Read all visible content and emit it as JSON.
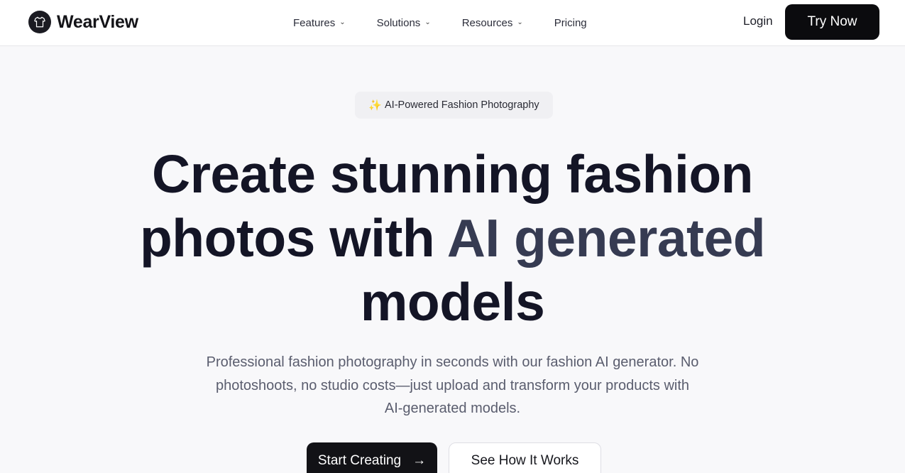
{
  "brand": {
    "name": "WearView",
    "logo_icon": "tshirt-icon"
  },
  "nav": {
    "items": [
      {
        "label": "Features",
        "has_dropdown": true
      },
      {
        "label": "Solutions",
        "has_dropdown": true
      },
      {
        "label": "Resources",
        "has_dropdown": true
      },
      {
        "label": "Pricing",
        "has_dropdown": false
      }
    ],
    "login_label": "Login",
    "cta_label": "Try Now"
  },
  "hero": {
    "badge_icon": "✨",
    "badge_text": "AI-Powered Fashion Photography",
    "headline_line1": "Create stunning fashion",
    "headline_line2_start": "photos with ",
    "headline_line2_accent": "AI generated",
    "headline_line3": "models",
    "subtitle": "Professional fashion photography in seconds with our fashion AI generator. No photoshoots, no studio costs—just upload and transform your products with AI-generated models.",
    "primary_cta": "Start Creating",
    "primary_cta_icon": "→",
    "secondary_cta": "See How It Works"
  },
  "colors": {
    "background": "#f8f8fa",
    "text": "#141526",
    "accent_text": "#363b52",
    "button_dark": "#0b0b0e"
  }
}
